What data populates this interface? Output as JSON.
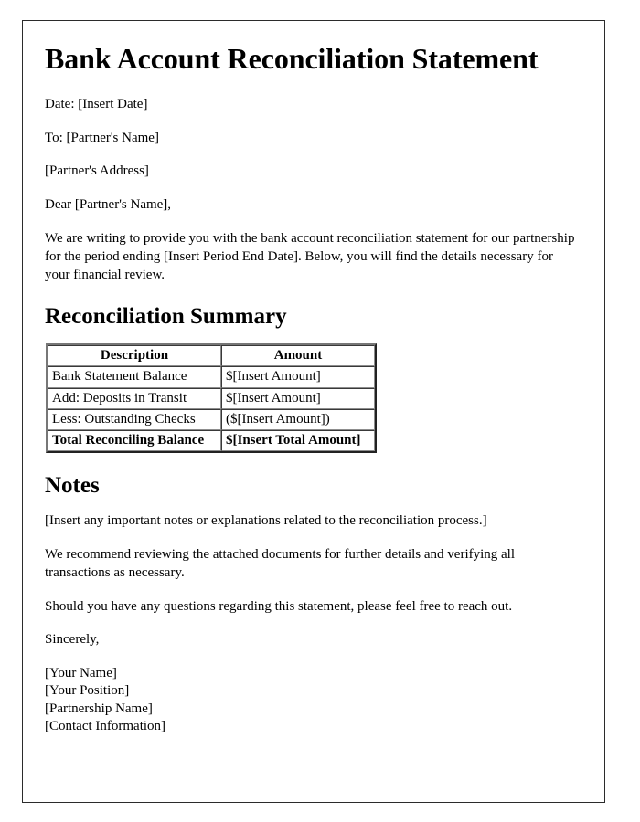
{
  "document": {
    "title": "Bank Account Reconciliation Statement",
    "header_lines": {
      "date": "Date: [Insert Date]",
      "to": "To: [Partner's Name]",
      "address": "[Partner's Address]",
      "salutation": "Dear [Partner's Name],"
    },
    "intro_paragraph": "We are writing to provide you with the bank account reconciliation statement for our partnership for the period ending [Insert Period End Date]. Below, you will find the details necessary for your financial review.",
    "summary_section": {
      "heading": "Reconciliation Summary",
      "table": {
        "columns": [
          "Description",
          "Amount"
        ],
        "rows": [
          {
            "description": "Bank Statement Balance",
            "amount": "$[Insert Amount]",
            "total": false
          },
          {
            "description": "Add: Deposits in Transit",
            "amount": "$[Insert Amount]",
            "total": false
          },
          {
            "description": "Less: Outstanding Checks",
            "amount": "($[Insert Amount])",
            "total": false
          },
          {
            "description": "Total Reconciling Balance",
            "amount": "$[Insert Total Amount]",
            "total": true
          }
        ]
      }
    },
    "notes_section": {
      "heading": "Notes",
      "placeholder": "[Insert any important notes or explanations related to the reconciliation process.]",
      "recommendation": "We recommend reviewing the attached documents for further details and verifying all transactions as necessary.",
      "questions": "Should you have any questions regarding this statement, please feel free to reach out."
    },
    "closing": {
      "sign_off": "Sincerely,",
      "signature_lines": [
        "[Your Name]",
        "[Your Position]",
        "[Partnership Name]",
        "[Contact Information]"
      ]
    }
  }
}
